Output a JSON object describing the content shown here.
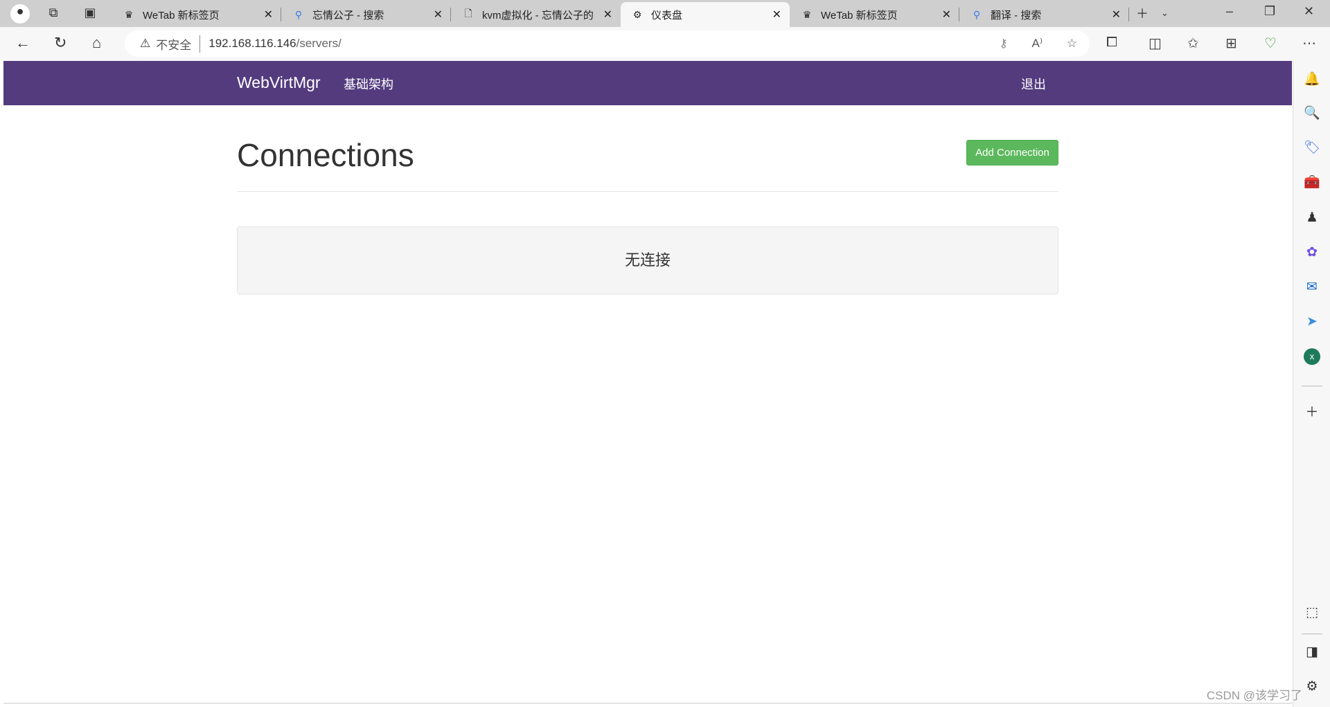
{
  "browser": {
    "tabs": [
      {
        "label": "WeTab 新标签页",
        "icon": "wetab-icon"
      },
      {
        "label": "忘情公子 - 搜索",
        "icon": "search-icon"
      },
      {
        "label": "kvm虚拟化 - 忘情公子的",
        "icon": "document-icon"
      },
      {
        "label": "仪表盘",
        "icon": "webvirtmgr-icon",
        "active": true
      },
      {
        "label": "WeTab 新标签页",
        "icon": "wetab-icon"
      },
      {
        "label": "翻译 - 搜索",
        "icon": "search-icon"
      }
    ],
    "security_label": "不安全",
    "url_host": "192.168.116.146",
    "url_path": "/servers/"
  },
  "navbar": {
    "brand": "WebVirtMgr",
    "link": "基础架构",
    "logout": "退出",
    "color": "#533b7e"
  },
  "main": {
    "title": "Connections",
    "add_button": "Add Connection",
    "empty_message": "无连接",
    "button_color": "#5cb85c"
  },
  "watermark": "CSDN @该学习了"
}
